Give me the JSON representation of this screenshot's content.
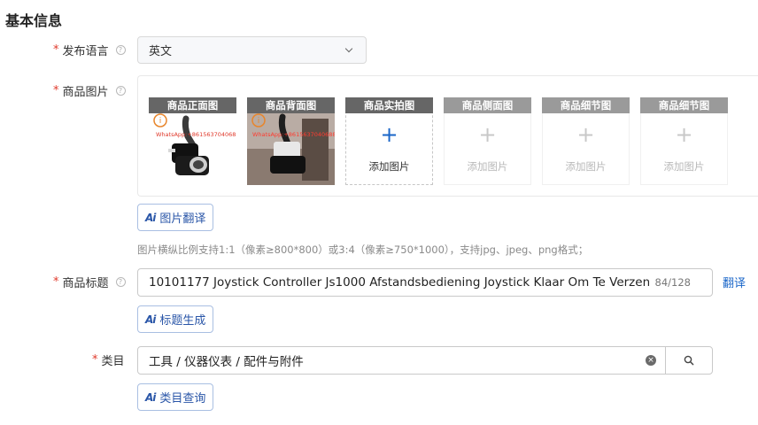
{
  "section": {
    "title": "基本信息"
  },
  "language": {
    "required_mark": "*",
    "label": "发布语言",
    "help_icon": "question-circle-icon",
    "selected": "英文",
    "chevron_icon": "chevron-down-icon"
  },
  "images": {
    "required_mark": "*",
    "label": "商品图片",
    "help_icon": "question-circle-icon",
    "slots": [
      {
        "header": "商品正面图",
        "state": "filled",
        "watermark": "WhatsApp:+8615637040688"
      },
      {
        "header": "商品背面图",
        "state": "filled",
        "watermark": "WhatsApp:+8615637040688"
      },
      {
        "header": "商品实拍图",
        "state": "active",
        "add_label": "添加图片"
      },
      {
        "header": "商品侧面图",
        "state": "disabled",
        "add_label": "添加图片"
      },
      {
        "header": "商品细节图",
        "state": "disabled",
        "add_label": "添加图片"
      },
      {
        "header": "商品细节图",
        "state": "disabled",
        "add_label": "添加图片"
      }
    ],
    "translate_button": {
      "icon_text": "Ai",
      "label": "图片翻译"
    },
    "hint": "图片横纵比例支持1:1（像素≥800*800）或3:4（像素≥750*1000），支持jpg、jpeg、png格式；"
  },
  "product_title": {
    "required_mark": "*",
    "label": "商品标题",
    "help_icon": "question-circle-icon",
    "value": "10101177 Joystick Controller Js1000 Afstandsbediening Joystick Klaar Om Te Verzenden",
    "count": "84/128",
    "translate_link": "翻译",
    "generate_button": {
      "icon_text": "Ai",
      "label": "标题生成"
    }
  },
  "category": {
    "required_mark": "*",
    "label": "类目",
    "value": "工具 / 仪器仪表 / 配件与附件",
    "clear_icon": "clear-circle-icon",
    "search_icon": "search-icon",
    "query_button": {
      "icon_text": "Ai",
      "label": "类目查询"
    }
  },
  "colors": {
    "required": "#e0392b",
    "link": "#1a66c8",
    "slot_header": "#666666",
    "ai_button_text": "#2a56a8"
  }
}
